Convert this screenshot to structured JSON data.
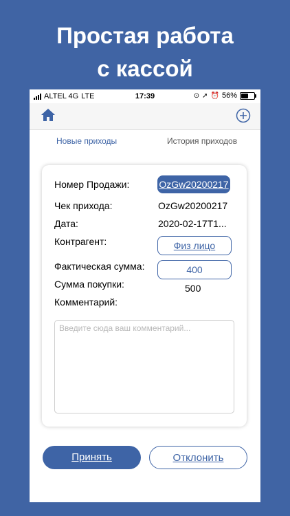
{
  "promo": {
    "line1": "Простая работа",
    "line2": "с кассой"
  },
  "statusbar": {
    "carrier": "ALTEL 4G",
    "network": "LTE",
    "time": "17:39",
    "battery_percent": "56%",
    "battery_level": 0.56
  },
  "navbar": {
    "home_icon": "home-icon",
    "add_icon": "plus-circle-icon"
  },
  "tabs": [
    {
      "label": "Новые приходы",
      "active": true
    },
    {
      "label": "История приходов",
      "active": false
    }
  ],
  "card": {
    "sale_number_label": "Номер Продажи:",
    "sale_number_value": "OzGw20200217",
    "receipt_label": "Чек прихода:",
    "receipt_value": "OzGw20200217",
    "date_label": "Дата:",
    "date_value": "2020-02-17T1...",
    "counterparty_label": "Контрагент:",
    "counterparty_value": "Физ лицо",
    "actual_sum_label": "Фактическая сумма:",
    "actual_sum_value": "400",
    "purchase_sum_label": "Сумма покупки:",
    "purchase_sum_value": "500",
    "comment_label": "Комментарий:",
    "comment_placeholder": "Введите сюда ваш комментарий..."
  },
  "actions": {
    "accept_label": "Принять",
    "decline_label": "Отклонить"
  },
  "colors": {
    "background": "#4064a4",
    "accent": "#3e64a6",
    "white": "#ffffff"
  }
}
